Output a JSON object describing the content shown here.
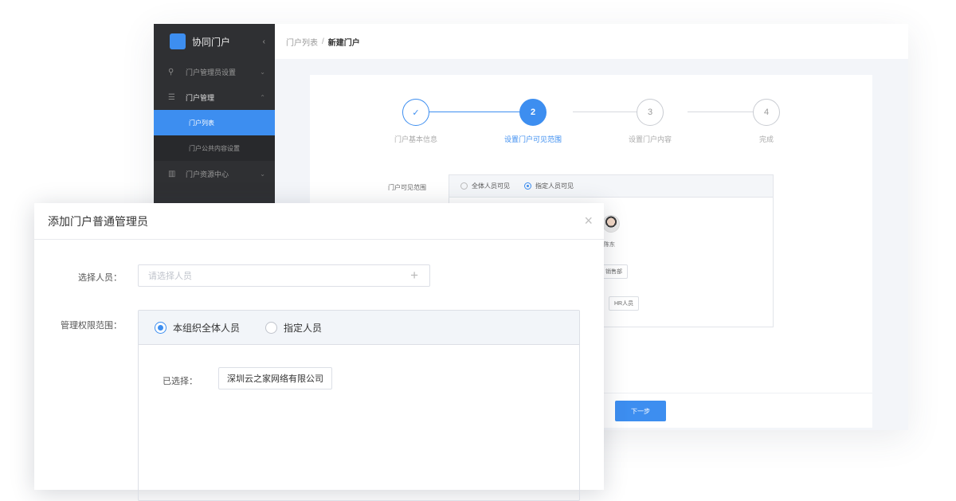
{
  "sidebar": {
    "brand": "协同门户",
    "collapse_icon": "chevron-left-icon",
    "items": [
      {
        "label": "门户管理员设置",
        "icon": "admin-icon"
      },
      {
        "label": "门户管理",
        "icon": "list-icon"
      },
      {
        "label": "门户列表"
      },
      {
        "label": "门户公共内容设置"
      },
      {
        "label": "门户资源中心",
        "icon": "resource-icon"
      }
    ]
  },
  "breadcrumb": {
    "parent": "门户列表",
    "separator": "/",
    "current": "新建门户"
  },
  "steps": [
    {
      "label": "门户基本信息",
      "marker": "✓",
      "state": "done"
    },
    {
      "label": "设置门户可见范围",
      "marker": "2",
      "state": "current"
    },
    {
      "label": "设置门户内容",
      "marker": "3",
      "state": "pending"
    },
    {
      "label": "完成",
      "marker": "4",
      "state": "pending"
    }
  ],
  "scope": {
    "label": "门户可见范围",
    "options": [
      "全体人员可见",
      "指定人员可见"
    ],
    "selected": "指定人员可见",
    "member_name": "陈东",
    "tags": [
      "销售部",
      "HR人员"
    ]
  },
  "footer": {
    "next_button": "下一步"
  },
  "modal": {
    "title": "添加门户普通管理员",
    "close": "×",
    "select_label": "选择人员：",
    "select_placeholder": "请选择人员",
    "select_add": "+",
    "perm_label": "管理权限范围：",
    "perm_options": [
      "本组织全体人员",
      "指定人员"
    ],
    "perm_selected": "本组织全体人员",
    "selected_label": "已选择：",
    "selected_org": "深圳云之家网络有限公司"
  },
  "colors": {
    "accent": "#3d8ef0",
    "sidebar_bg": "#2f3033"
  }
}
